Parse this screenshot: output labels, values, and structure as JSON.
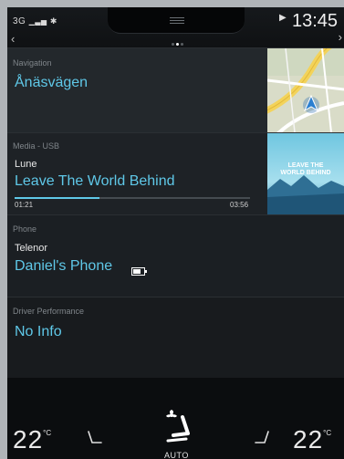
{
  "status": {
    "signal": "3G",
    "time": "13:45"
  },
  "navigation": {
    "label": "Navigation",
    "destination": "Ånäsvägen"
  },
  "media": {
    "label": "Media - USB",
    "artist": "Lune",
    "track": "Leave The World Behind",
    "elapsed": "01:21",
    "duration": "03:56",
    "progress_fraction": 0.36,
    "album_art_text": "LEAVE THE WORLD BEHIND"
  },
  "phone": {
    "label": "Phone",
    "carrier": "Telenor",
    "device": "Daniel's Phone"
  },
  "driver": {
    "label": "Driver Performance",
    "value": "No Info"
  },
  "climate": {
    "left_temp": "22",
    "right_temp": "22",
    "unit": "°C",
    "mode": "AUTO"
  },
  "colors": {
    "accent": "#5fc8e8",
    "background": "#0d0f11"
  }
}
